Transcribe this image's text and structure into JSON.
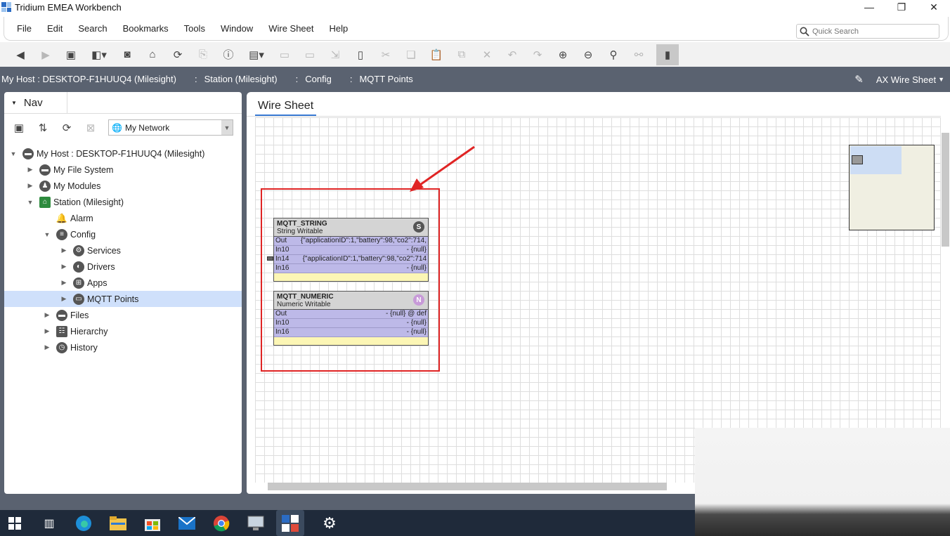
{
  "window": {
    "title": "Tridium EMEA Workbench",
    "controls": [
      "—",
      "❐",
      "✕"
    ]
  },
  "menu": {
    "items": [
      "File",
      "Edit",
      "Search",
      "Bookmarks",
      "Tools",
      "Window",
      "Wire Sheet",
      "Help"
    ]
  },
  "search": {
    "placeholder": "Quick Search"
  },
  "breadcrumb": {
    "items": [
      "My Host : DESKTOP-F1HUUQ4 (Milesight)",
      "Station (Milesight)",
      "Config",
      "MQTT Points"
    ],
    "view_label": "AX Wire Sheet"
  },
  "nav": {
    "tab_label": "Nav",
    "network_select": "My Network",
    "tree": [
      {
        "label": "My Host : DESKTOP-F1HUUQ4 (Milesight)",
        "icon": "host-icon",
        "expanded": true
      },
      {
        "label": "My File System",
        "icon": "drive-icon"
      },
      {
        "label": "My Modules",
        "icon": "modules-icon"
      },
      {
        "label": "Station (Milesight)",
        "icon": "station-icon",
        "expanded": true
      },
      {
        "label": "Alarm",
        "icon": "bell-icon"
      },
      {
        "label": "Config",
        "icon": "database-icon",
        "expanded": true
      },
      {
        "label": "Services",
        "icon": "services-icon"
      },
      {
        "label": "Drivers",
        "icon": "drivers-icon"
      },
      {
        "label": "Apps",
        "icon": "apps-icon"
      },
      {
        "label": "MQTT Points",
        "icon": "folder-icon",
        "selected": true
      },
      {
        "label": "Files",
        "icon": "files-icon"
      },
      {
        "label": "Hierarchy",
        "icon": "hierarchy-icon"
      },
      {
        "label": "History",
        "icon": "history-icon"
      }
    ]
  },
  "wiresheet": {
    "tab_label": "Wire Sheet",
    "components": [
      {
        "name": "MQTT_STRING",
        "type": "String Writable",
        "badge": "S",
        "badge_color": "#555555",
        "slots": [
          {
            "name": "Out",
            "value": "{\"applicationID\":1,\"battery\":98,\"co2\":714,"
          },
          {
            "name": "In10",
            "value": "- {null}"
          },
          {
            "name": "In14",
            "value": "{\"applicationID\":1,\"battery\":98,\"co2\":714"
          },
          {
            "name": "In16",
            "value": "- {null}"
          }
        ]
      },
      {
        "name": "MQTT_NUMERIC",
        "type": "Numeric Writable",
        "badge": "N",
        "badge_color": "#c79ad8",
        "slots": [
          {
            "name": "Out",
            "value": "- {null} @ def"
          },
          {
            "name": "In10",
            "value": "- {null}"
          },
          {
            "name": "In16",
            "value": "- {null}"
          }
        ]
      }
    ],
    "annotation_color": "#e02424"
  }
}
